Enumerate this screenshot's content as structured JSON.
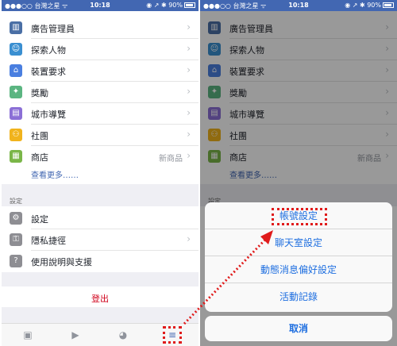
{
  "status": {
    "carrier": "●●●○○ 台灣之星 ᯤ",
    "time": "10:18",
    "right": "◉ ↗ ✱ 90%"
  },
  "menu": {
    "items": [
      {
        "label": "廣告管理員",
        "badge": "",
        "icon_color": "#4a6fa5",
        "icon": "chart-icon",
        "glyph": "▥"
      },
      {
        "label": "探索人物",
        "badge": "",
        "icon_color": "#3a8fd1",
        "icon": "people-search-icon",
        "glyph": "☺"
      },
      {
        "label": "裝置要求",
        "badge": "",
        "icon_color": "#4a7fe0",
        "icon": "home-icon",
        "glyph": "⌂"
      },
      {
        "label": "獎勵",
        "badge": "",
        "icon_color": "#5bb581",
        "icon": "puzzle-icon",
        "glyph": "✦"
      },
      {
        "label": "城市導覽",
        "badge": "",
        "icon_color": "#8b6fd6",
        "icon": "city-icon",
        "glyph": "▤"
      },
      {
        "label": "社團",
        "badge": "",
        "icon_color": "#f1b31c",
        "icon": "group-icon",
        "glyph": "⚇"
      },
      {
        "label": "商店",
        "badge": "新商品",
        "icon_color": "#7ab648",
        "icon": "shop-icon",
        "glyph": "▦"
      }
    ],
    "see_more": "查看更多……",
    "section_header": "設定",
    "settings_items": [
      {
        "label": "設定",
        "icon_color": "#8e8e93",
        "icon": "gear-icon",
        "glyph": "⚙"
      },
      {
        "label": "隱私捷徑",
        "icon_color": "#8e8e93",
        "icon": "lock-icon",
        "glyph": "⚿"
      },
      {
        "label": "使用說明與支援",
        "icon_color": "#8e8e93",
        "icon": "help-icon",
        "glyph": "?"
      }
    ],
    "logout": "登出"
  },
  "tabs": [
    "feed-icon",
    "video-icon",
    "globe-icon",
    "menu-icon"
  ],
  "sheet": {
    "options": [
      "帳號設定",
      "聊天室設定",
      "動態消息偏好設定",
      "活動記錄"
    ],
    "cancel": "取消"
  },
  "colors": {
    "brand": "#4267b2",
    "logout": "#d0021b",
    "annotation": "#e01b1b",
    "sheet_text": "#1f6fe0"
  }
}
